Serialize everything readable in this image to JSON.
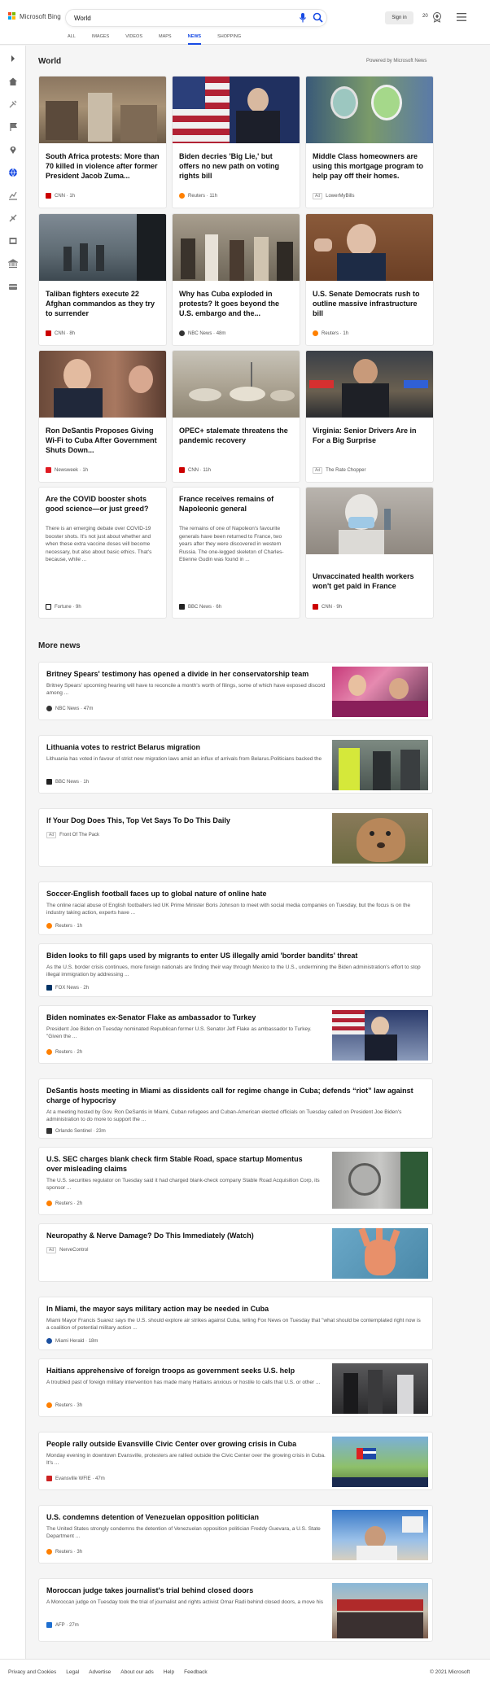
{
  "header": {
    "brand": "Microsoft Bing",
    "search_value": "World",
    "signin_label": "Sign in",
    "rewards_count": "20",
    "tabs": [
      "ALL",
      "IMAGES",
      "VIDEOS",
      "MAPS",
      "NEWS",
      "SHOPPING"
    ],
    "active_tab": "NEWS",
    "accent": "#174ae4"
  },
  "rail": {
    "icons": [
      "chevron-right-icon",
      "home-icon",
      "tools-icon",
      "flag-icon",
      "location-icon",
      "globe-icon",
      "chart-icon",
      "science-icon",
      "film-icon",
      "bank-icon",
      "card-icon"
    ]
  },
  "main": {
    "section_title": "World",
    "powered_by": "Powered by Microsoft News",
    "cards": [
      {
        "title": "South Africa protests: More than 70 killed in violence after former President Jacob Zuma...",
        "source": "CNN",
        "time": "1h",
        "logo_color": "#cc0000"
      },
      {
        "title": "Biden decries 'Big Lie,' but offers no new path on voting rights bill",
        "source": "Reuters",
        "time": "11h",
        "logo_color": "#ff8000"
      },
      {
        "title": "Middle Class homeowners are using this mortgage program to help pay off their homes.",
        "source": "LowerMyBills",
        "ad": "Ad",
        "time": "",
        "logo_color": ""
      },
      {
        "title": "Taliban fighters execute 22 Afghan commandos as they try to surrender",
        "source": "CNN",
        "time": "8h",
        "logo_color": "#cc0000"
      },
      {
        "title": "Why has Cuba exploded in protests? It goes beyond the U.S. embargo and the...",
        "source": "NBC News",
        "time": "48m",
        "logo_color": "#333333"
      },
      {
        "title": "U.S. Senate Democrats rush to outline massive infrastructure bill",
        "source": "Reuters",
        "time": "1h",
        "logo_color": "#ff8000"
      },
      {
        "title": "Ron DeSantis Proposes Giving Wi-Fi to Cuba After Government Shuts Down...",
        "source": "Newsweek",
        "time": "1h",
        "logo_color": "#e01a22"
      },
      {
        "title": "OPEC+ stalemate threatens the pandemic recovery",
        "source": "CNN",
        "time": "11h",
        "logo_color": "#cc0000"
      },
      {
        "title": "Virginia: Senior Drivers Are in For a Big Surprise",
        "source": "The Rate Chopper",
        "ad": "Ad",
        "time": "",
        "logo_color": ""
      },
      {
        "title": "Are the COVID booster shots good science—or just greed?",
        "snippet": "There is an emerging debate over COVID-19 booster shots. It's not just about whether and when these extra vaccine doses will become necessary, but also about basic ethics. That's because, while ...",
        "source": "Fortune",
        "time": "9h",
        "logo_color": "#111111"
      },
      {
        "title": "France receives remains of Napoleonic general",
        "snippet": "The remains of one of Napoleon's favourite generals have been returned to France, two years after they were discovered in western Russia. The one-legged skeleton of Charles-Etienne Gudin was found in ...",
        "source": "BBC News",
        "time": "6h",
        "logo_color": "#222222"
      },
      {
        "title": "Unvaccinated health workers won't get paid in France",
        "source": "CNN",
        "time": "9h",
        "logo_color": "#cc0000"
      }
    ]
  },
  "more_news": {
    "title": "More news",
    "items": [
      {
        "title": "Britney Spears' testimony has opened a divide in her conservatorship team",
        "snippet": "Britney Spears' upcoming hearing will have to reconcile a month's worth of filings, some of which have exposed discord among ...",
        "source": "NBC News",
        "time": "47m",
        "logo_color": "#333333"
      },
      {
        "title": "Lithuania votes to restrict Belarus migration",
        "snippet": "Lithuania has voted in favour of strict new migration laws amid an influx of arrivals from Belarus.Politicians backed the",
        "source": "BBC News",
        "time": "1h",
        "logo_color": "#222222"
      },
      {
        "title": "If Your Dog Does This, Top Vet Says To Do This Daily",
        "snippet": "",
        "source": "Front Of The Pack",
        "ad": "Ad",
        "time": "",
        "logo_color": ""
      },
      {
        "title": "Soccer-English football faces up to global nature of online hate",
        "snippet": "The online racial abuse of English footballers led UK Prime Minister Boris Johnson to meet with social media companies on Tuesday, but the focus is on the industry taking action, experts have ...",
        "source": "Reuters",
        "time": "1h",
        "logo_color": "#ff8000"
      },
      {
        "title": "Biden looks to fill gaps used by migrants to enter US illegally amid 'border bandits' threat",
        "snippet": "As the U.S. border crisis continues, more foreign nationals are finding their way through Mexico to the U.S., undermining the Biden administration's effort to stop illegal immigration by addressing ...",
        "source": "FOX News",
        "time": "2h",
        "logo_color": "#003366"
      },
      {
        "title": "Biden nominates ex-Senator Flake as ambassador to Turkey",
        "snippet": "President Joe Biden on Tuesday nominated Republican former U.S. Senator Jeff Flake as ambassador to Turkey. \"Given the ...",
        "source": "Reuters",
        "time": "2h",
        "logo_color": "#ff8000"
      },
      {
        "title": "DeSantis hosts meeting in Miami as dissidents call for regime change in Cuba; defends “riot” law against charge of hypocrisy",
        "snippet": "At a meeting hosted by Gov. Ron DeSantis in Miami, Cuban refugees and Cuban-American elected officials on Tuesday called on President Joe Biden's administration to do more to support the ...",
        "source": "Orlando Sentinel",
        "time": "23m",
        "logo_color": "#333333"
      },
      {
        "title": "U.S. SEC charges blank check firm Stable Road, space startup Momentus over misleading claims",
        "snippet": "The U.S. securities regulator on Tuesday said it had charged blank-check company Stable Road Acquisition Corp, its sponsor ...",
        "source": "Reuters",
        "time": "2h",
        "logo_color": "#ff8000"
      },
      {
        "title": "Neuropathy & Nerve Damage? Do This Immediately (Watch)",
        "snippet": "",
        "source": "NerveControl",
        "ad": "Ad",
        "time": "",
        "logo_color": ""
      },
      {
        "title": "In Miami, the mayor says military action may be needed in Cuba",
        "snippet": "Miami Mayor Francis Suarez says the U.S. should explore air strikes against Cuba, telling Fox News on Tuesday that \"what should be contemplated right now is a coalition of potential military action ...",
        "source": "Miami Herald",
        "time": "18m",
        "logo_color": "#1a4fa0"
      },
      {
        "title": "Haitians apprehensive of foreign troops as government seeks U.S. help",
        "snippet": "A troubled past of foreign military intervention has made many Haitians anxious or hostile to calls that U.S. or other ...",
        "source": "Reuters",
        "time": "3h",
        "logo_color": "#ff8000"
      },
      {
        "title": "People rally outside Evansville Civic Center over growing crisis in Cuba",
        "snippet": "Monday evening in downtown Evansville, protesters are rallied outside the Civic Center over the growing crisis in Cuba. It's ...",
        "source": "Evansville WFIE",
        "time": "47m",
        "logo_color": "#cc2222"
      },
      {
        "title": "U.S. condemns detention of Venezuelan opposition politician",
        "snippet": "The United States strongly condemns the detention of Venezuelan opposition politician Freddy Guevara, a U.S. State Department ...",
        "source": "Reuters",
        "time": "3h",
        "logo_color": "#ff8000"
      },
      {
        "title": "Moroccan judge takes journalist's trial behind closed doors",
        "snippet": "A Moroccan judge on Tuesday took the trial of journalist and rights activist Omar Radi behind closed doors, a move his",
        "source": "AFP",
        "time": "27m",
        "logo_color": "#1e6fd0"
      }
    ]
  },
  "footer": {
    "links": [
      "Privacy and Cookies",
      "Legal",
      "Advertise",
      "About our ads",
      "Help",
      "Feedback"
    ],
    "copyright": "© 2021 Microsoft"
  }
}
